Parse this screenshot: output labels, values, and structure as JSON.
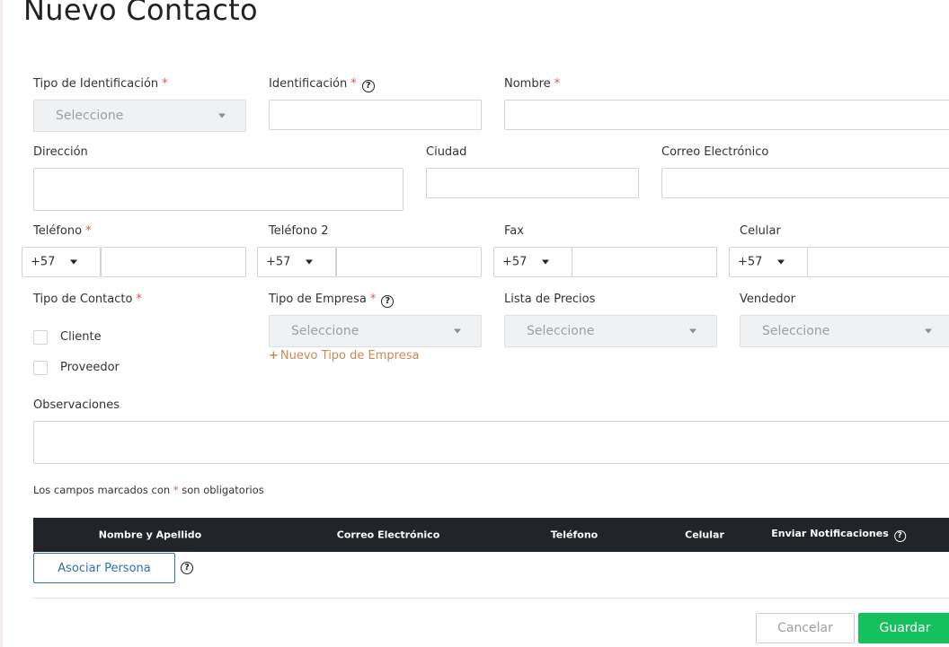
{
  "page": {
    "title": "Nuevo Contacto"
  },
  "required_mark": "*",
  "help_glyph": "?",
  "fields": {
    "tipo_identificacion": {
      "label": "Tipo de Identificación",
      "placeholder": "Seleccione"
    },
    "identificacion": {
      "label": "Identificación",
      "value": ""
    },
    "nombre": {
      "label": "Nombre",
      "value": ""
    },
    "direccion": {
      "label": "Dirección",
      "value": ""
    },
    "ciudad": {
      "label": "Ciudad",
      "value": ""
    },
    "correo": {
      "label": "Correo Electrónico",
      "value": ""
    },
    "telefono": {
      "label": "Teléfono",
      "prefix": "+57",
      "value": ""
    },
    "telefono2": {
      "label": "Teléfono 2",
      "prefix": "+57",
      "value": ""
    },
    "fax": {
      "label": "Fax",
      "prefix": "+57",
      "value": ""
    },
    "celular": {
      "label": "Celular",
      "prefix": "+57",
      "value": ""
    },
    "tipo_contacto": {
      "label": "Tipo de Contacto",
      "options": [
        "Cliente",
        "Proveedor"
      ]
    },
    "tipo_empresa": {
      "label": "Tipo de Empresa",
      "placeholder": "Seleccione",
      "add_link": "Nuevo Tipo de Empresa",
      "add_glyph": "+"
    },
    "lista_precios": {
      "label": "Lista de Precios",
      "placeholder": "Seleccione"
    },
    "vendedor": {
      "label": "Vendedor",
      "placeholder": "Seleccione"
    },
    "observaciones": {
      "label": "Observaciones",
      "value": ""
    }
  },
  "required_note": {
    "before": "Los campos marcados con",
    "mark": "*",
    "after": "son obligatorios"
  },
  "persons_table": {
    "columns": [
      "Nombre y Apellido",
      "Correo Electrónico",
      "Teléfono",
      "Celular",
      "Enviar Notificaciones"
    ],
    "associate_button": "Asociar Persona"
  },
  "actions": {
    "cancel": "Cancelar",
    "save": "Guardar"
  },
  "colors": {
    "header_bg": "#212529",
    "save_bg": "#15c15d",
    "link": "#c98a52",
    "required": "#e55353",
    "outline_btn": "#2f6db5"
  }
}
